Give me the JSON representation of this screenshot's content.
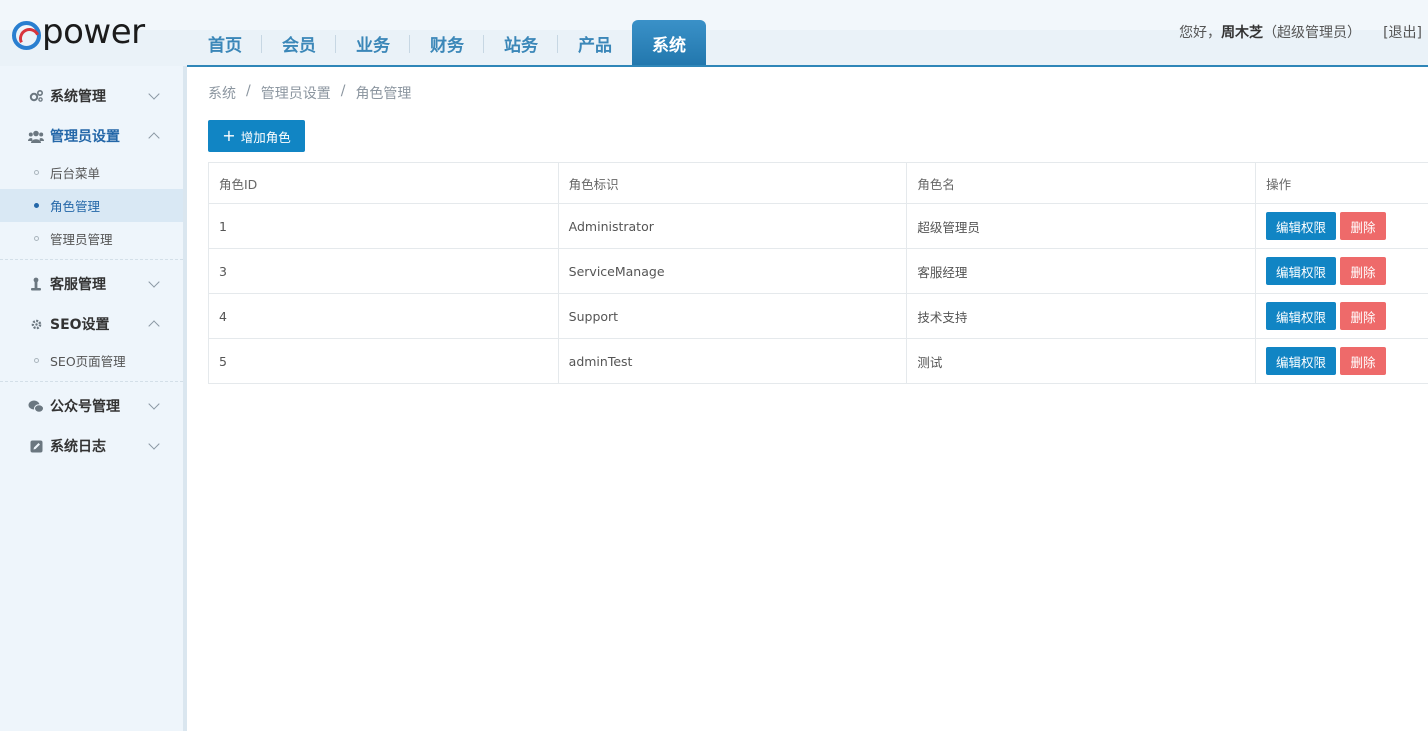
{
  "header": {
    "logo_text": "power",
    "nav": [
      {
        "label": "首页"
      },
      {
        "label": "会员"
      },
      {
        "label": "业务"
      },
      {
        "label": "财务"
      },
      {
        "label": "站务"
      },
      {
        "label": "产品"
      },
      {
        "label": "系统"
      }
    ],
    "active_nav": "系统",
    "greeting": "您好，",
    "user_name": "周木芝",
    "user_role": "（超级管理员）",
    "logout": "[退出]"
  },
  "sidebar": {
    "groups": [
      {
        "label": "系统管理",
        "icon": "gears-icon",
        "open": false
      },
      {
        "label": "管理员设置",
        "icon": "users-icon",
        "open": true,
        "items": [
          {
            "label": "后台菜单"
          },
          {
            "label": "角色管理"
          },
          {
            "label": "管理员管理"
          }
        ]
      },
      {
        "label": "客服管理",
        "icon": "support-icon",
        "open": false
      },
      {
        "label": "SEO设置",
        "icon": "gear-icon",
        "open": true,
        "items": [
          {
            "label": "SEO页面管理"
          }
        ]
      },
      {
        "label": "公众号管理",
        "icon": "wechat-icon",
        "open": false
      },
      {
        "label": "系统日志",
        "icon": "edit-icon",
        "open": false
      }
    ],
    "active_item": "角色管理"
  },
  "breadcrumb": [
    "系统",
    "/",
    "管理员设置",
    "/",
    "角色管理"
  ],
  "toolbar": {
    "add_label": "增加角色"
  },
  "table": {
    "headers": [
      "角色ID",
      "角色标识",
      "角色名",
      "操作"
    ],
    "rows": [
      {
        "id": "1",
        "key": "Administrator",
        "name": "超级管理员"
      },
      {
        "id": "3",
        "key": "ServiceManage",
        "name": "客服经理"
      },
      {
        "id": "4",
        "key": "Support",
        "name": "技术支持"
      },
      {
        "id": "5",
        "key": "adminTest",
        "name": "测试"
      }
    ],
    "edit_label": "编辑权限",
    "delete_label": "删除"
  },
  "colors": {
    "primary": "#1185c4",
    "danger": "#ee6a6a",
    "nav_active": "#2a80b8"
  }
}
